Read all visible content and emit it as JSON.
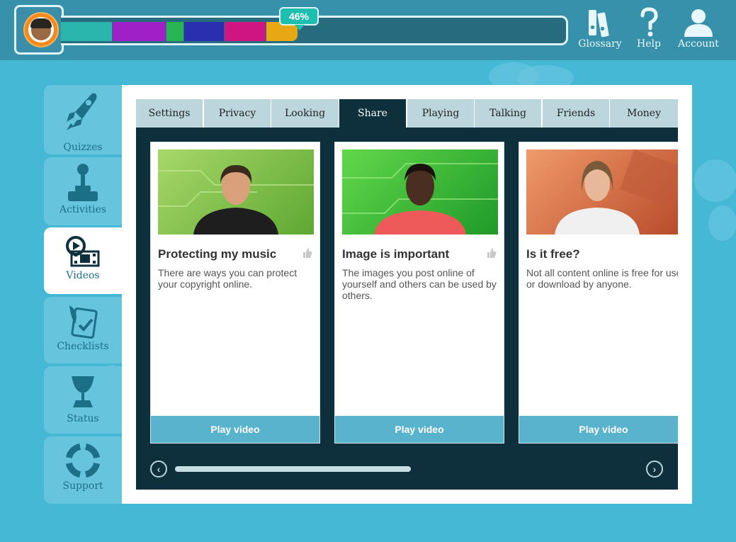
{
  "header": {
    "progress": {
      "percent_label": "46%",
      "value": 46,
      "segments": [
        {
          "color": "#2bb6ad"
        },
        {
          "color": "#a020c8"
        },
        {
          "color": "#2ab555"
        },
        {
          "color": "#2830b0"
        },
        {
          "color": "#cf1580"
        },
        {
          "color": "#e8a814"
        }
      ]
    },
    "nav": [
      {
        "label": "Glossary",
        "icon": "glossary-books-icon"
      },
      {
        "label": "Help",
        "icon": "question-mark-icon"
      },
      {
        "label": "Account",
        "icon": "user-icon"
      }
    ]
  },
  "sidebar": {
    "items": [
      {
        "label": "Quizzes",
        "icon": "rocket-icon",
        "active": false
      },
      {
        "label": "Activities",
        "icon": "joystick-icon",
        "active": false
      },
      {
        "label": "Videos",
        "icon": "video-film-icon",
        "active": true
      },
      {
        "label": "Checklists",
        "icon": "checklist-icon",
        "active": false
      },
      {
        "label": "Status",
        "icon": "trophy-icon",
        "active": false
      },
      {
        "label": "Support",
        "icon": "lifebuoy-icon",
        "active": false
      }
    ]
  },
  "tabs": [
    "Settings",
    "Privacy",
    "Looking",
    "Share",
    "Playing",
    "Talking",
    "Friends",
    "Money"
  ],
  "active_tab": "Share",
  "videos": [
    {
      "title": "Protecting my music",
      "description": "There are ways you can protect your copyright online.",
      "button": "Play video",
      "thumb_bg": "#7fbf3e",
      "shirt": "#1e1e1e",
      "skin": "#d9a07c",
      "hair": "#3a2a1e"
    },
    {
      "title": "Image is important",
      "description": "The images you post online of yourself and others can be used by others.",
      "button": "Play video",
      "thumb_bg": "#3ab83a",
      "shirt": "#ee5a5a",
      "skin": "#4a2e22",
      "hair": "#1a120e"
    },
    {
      "title": "Is it free?",
      "description": "Not all content online is free for use or download by anyone.",
      "button": "Play video",
      "thumb_bg": "#d46a44",
      "shirt": "#f0f0f0",
      "skin": "#e8b89a",
      "hair": "#7a5a3a"
    }
  ]
}
